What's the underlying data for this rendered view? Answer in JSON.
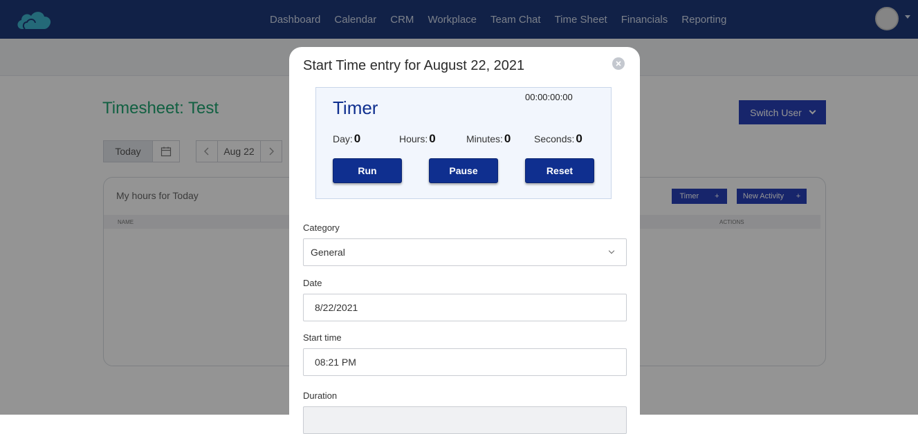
{
  "nav": {
    "items": [
      {
        "label": "Dashboard"
      },
      {
        "label": "Calendar"
      },
      {
        "label": "CRM"
      },
      {
        "label": "Workplace"
      },
      {
        "label": "Team Chat"
      },
      {
        "label": "Time Sheet"
      },
      {
        "label": "Financials"
      },
      {
        "label": "Reporting"
      }
    ]
  },
  "page": {
    "title": "Timesheet: Test",
    "switch_user_label": "Switch User",
    "today_label": "Today",
    "date_label": "Aug 22",
    "card": {
      "title": "My hours for Today",
      "timer_label": "Timer",
      "new_activity_label": "New Activity",
      "columns": [
        "NAME",
        "ACTIONS"
      ]
    }
  },
  "modal": {
    "title": "Start Time entry for August 22, 2021",
    "timer": {
      "heading": "Timer",
      "clock": "00:00:00:00",
      "day_label": "Day:",
      "day_value": "0",
      "hours_label": "Hours:",
      "hours_value": "0",
      "minutes_label": "Minutes:",
      "minutes_value": "0",
      "seconds_label": "Seconds:",
      "seconds_value": "0",
      "run_label": "Run",
      "pause_label": "Pause",
      "reset_label": "Reset"
    },
    "category": {
      "label": "Category",
      "value": "General"
    },
    "date": {
      "label": "Date",
      "value": "8/22/2021"
    },
    "start_time": {
      "label": "Start time",
      "value": "08:21 PM"
    },
    "duration": {
      "label": "Duration",
      "value": ""
    }
  },
  "colors": {
    "navbar": "#1e3a7a",
    "primary": "#0f2f8f",
    "title_green": "#1fa672",
    "button_blue": "#2940b8"
  }
}
